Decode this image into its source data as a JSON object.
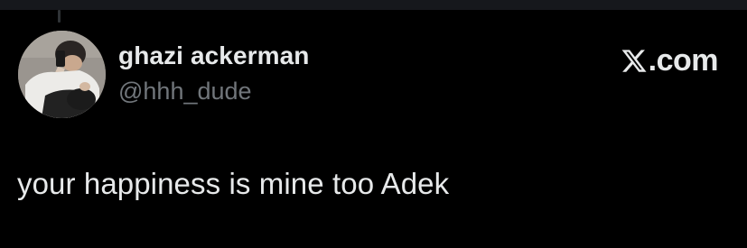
{
  "author": {
    "display_name": "ghazi ackerman",
    "handle": "@hhh_dude",
    "avatar_icon": "profile-photo"
  },
  "brand": {
    "logo_icon": "x-logo-icon",
    "text": ".com"
  },
  "tweet": {
    "text": "your happiness is mine too Adek"
  },
  "colors": {
    "background": "#000000",
    "primary_text": "#e7e9ea",
    "secondary_text": "#71767b"
  }
}
